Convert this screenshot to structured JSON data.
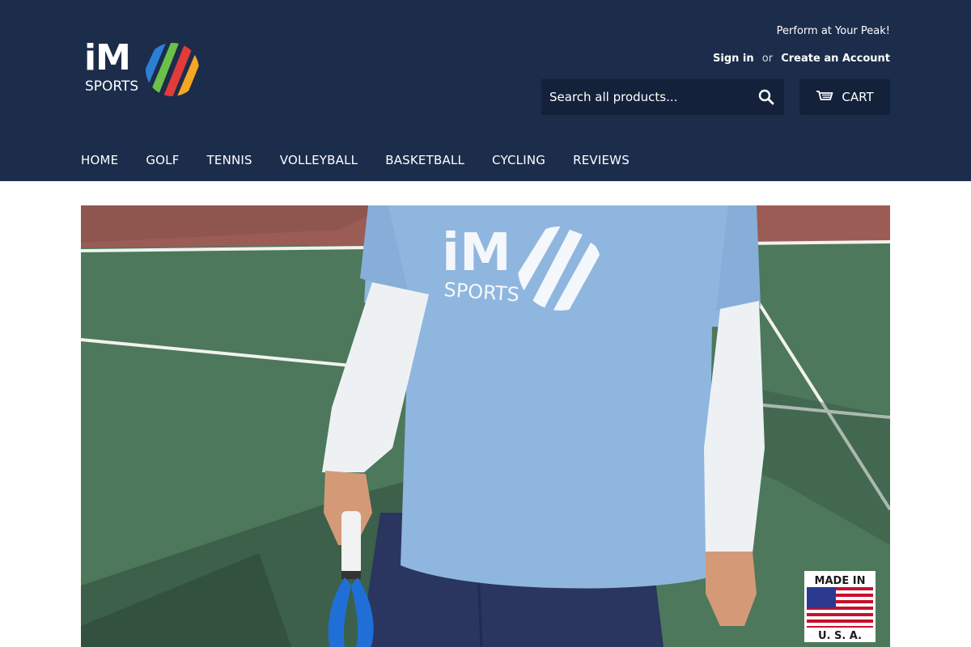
{
  "header": {
    "tagline": "Perform at Your Peak!",
    "logo": {
      "brand": "iM",
      "sub": "SPORTS"
    },
    "account": {
      "sign_in": "Sign in",
      "or": "or",
      "create_account": "Create an Account"
    },
    "search": {
      "placeholder": "Search all products...",
      "icon": "search-icon"
    },
    "cart": {
      "label": "CART",
      "icon": "cart-icon"
    }
  },
  "nav": {
    "items": [
      "HOME",
      "GOLF",
      "TENNIS",
      "VOLLEYBALL",
      "BASKETBALL",
      "CYCLING",
      "REVIEWS"
    ]
  },
  "hero": {
    "shirt_logo": {
      "brand": "iM",
      "sub": "SPORTS"
    },
    "badge": {
      "top": "MADE IN",
      "bottom": "U. S. A."
    }
  },
  "colors": {
    "header_bg": "#1c2c4b",
    "control_bg": "#13213a",
    "court_green": "#4f7a5d",
    "court_red": "#9b5a52",
    "shirt_blue": "#8fb6de",
    "logo_blue": "#2d7fd6",
    "logo_green": "#6cc04a",
    "logo_red": "#e23b3b",
    "logo_orange": "#f5a623"
  }
}
